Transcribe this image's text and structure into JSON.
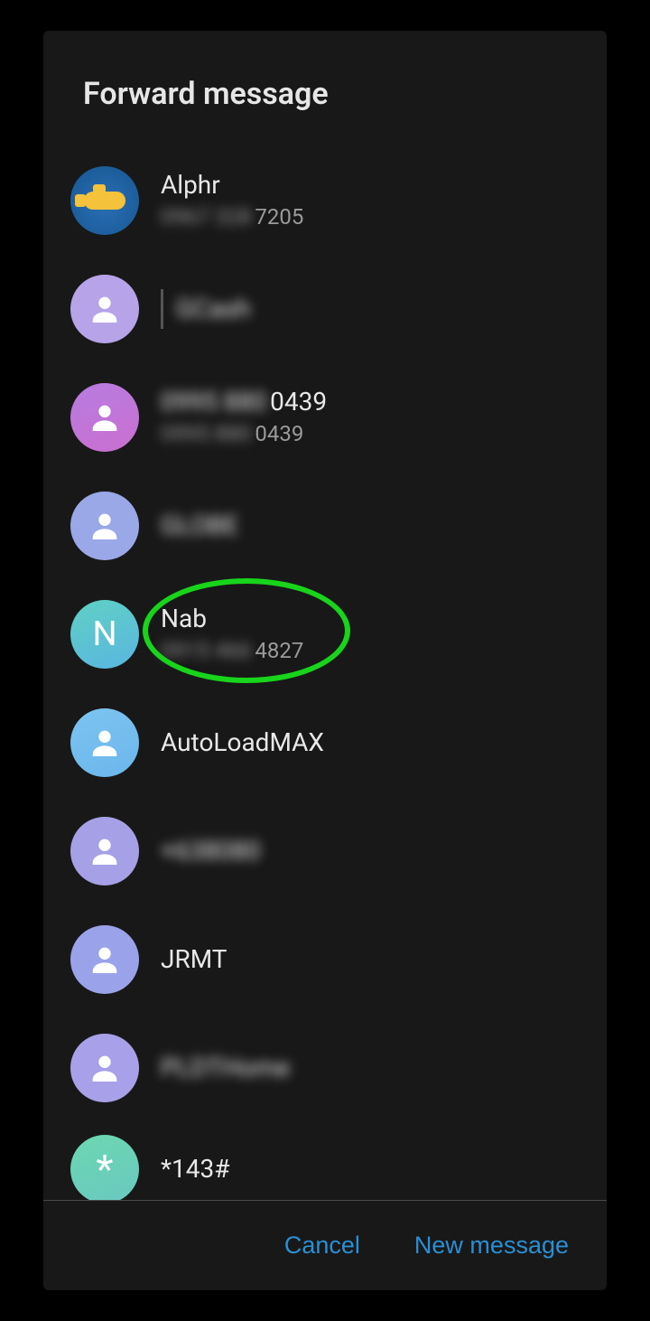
{
  "dialog": {
    "title": "Forward message"
  },
  "contacts": [
    {
      "name": "Alphr",
      "sub_hidden": "0967 328",
      "sub_visible": "7205",
      "avatar": "submarine"
    },
    {
      "name_hidden": "GCash",
      "avatar_bg": "#b6a3e8",
      "has_pipe": true
    },
    {
      "name_hidden": "0995 880",
      "name_visible": "0439",
      "sub_hidden": "0995 880",
      "sub_visible": "0439",
      "avatar_bg": "linear-gradient(160deg,#b87ce0,#c96fd0)"
    },
    {
      "name_hidden": "GLOBE",
      "avatar_bg": "#9aa8e8"
    },
    {
      "name": "Nab",
      "sub_hidden": "0915 466",
      "sub_visible": "4827",
      "avatar_bg": "linear-gradient(160deg,#5fd0c4,#5ab6e0)",
      "letter": "N",
      "highlight": true
    },
    {
      "name": "AutoLoadMAX",
      "avatar_bg": "linear-gradient(160deg,#7cc4f0,#6bb6ec)"
    },
    {
      "name_hidden": "+638080",
      "avatar_bg": "#a6a1e6"
    },
    {
      "name": "JRMT",
      "avatar_bg": "#9aa2ea"
    },
    {
      "name_hidden": "PLDTHome",
      "avatar_bg": "#a8a0e8"
    },
    {
      "name": "*143#",
      "avatar_bg": "linear-gradient(160deg,#6cd7b0,#6ac8c0)",
      "letter": "*"
    }
  ],
  "footer": {
    "cancel": "Cancel",
    "new_message": "New message"
  }
}
